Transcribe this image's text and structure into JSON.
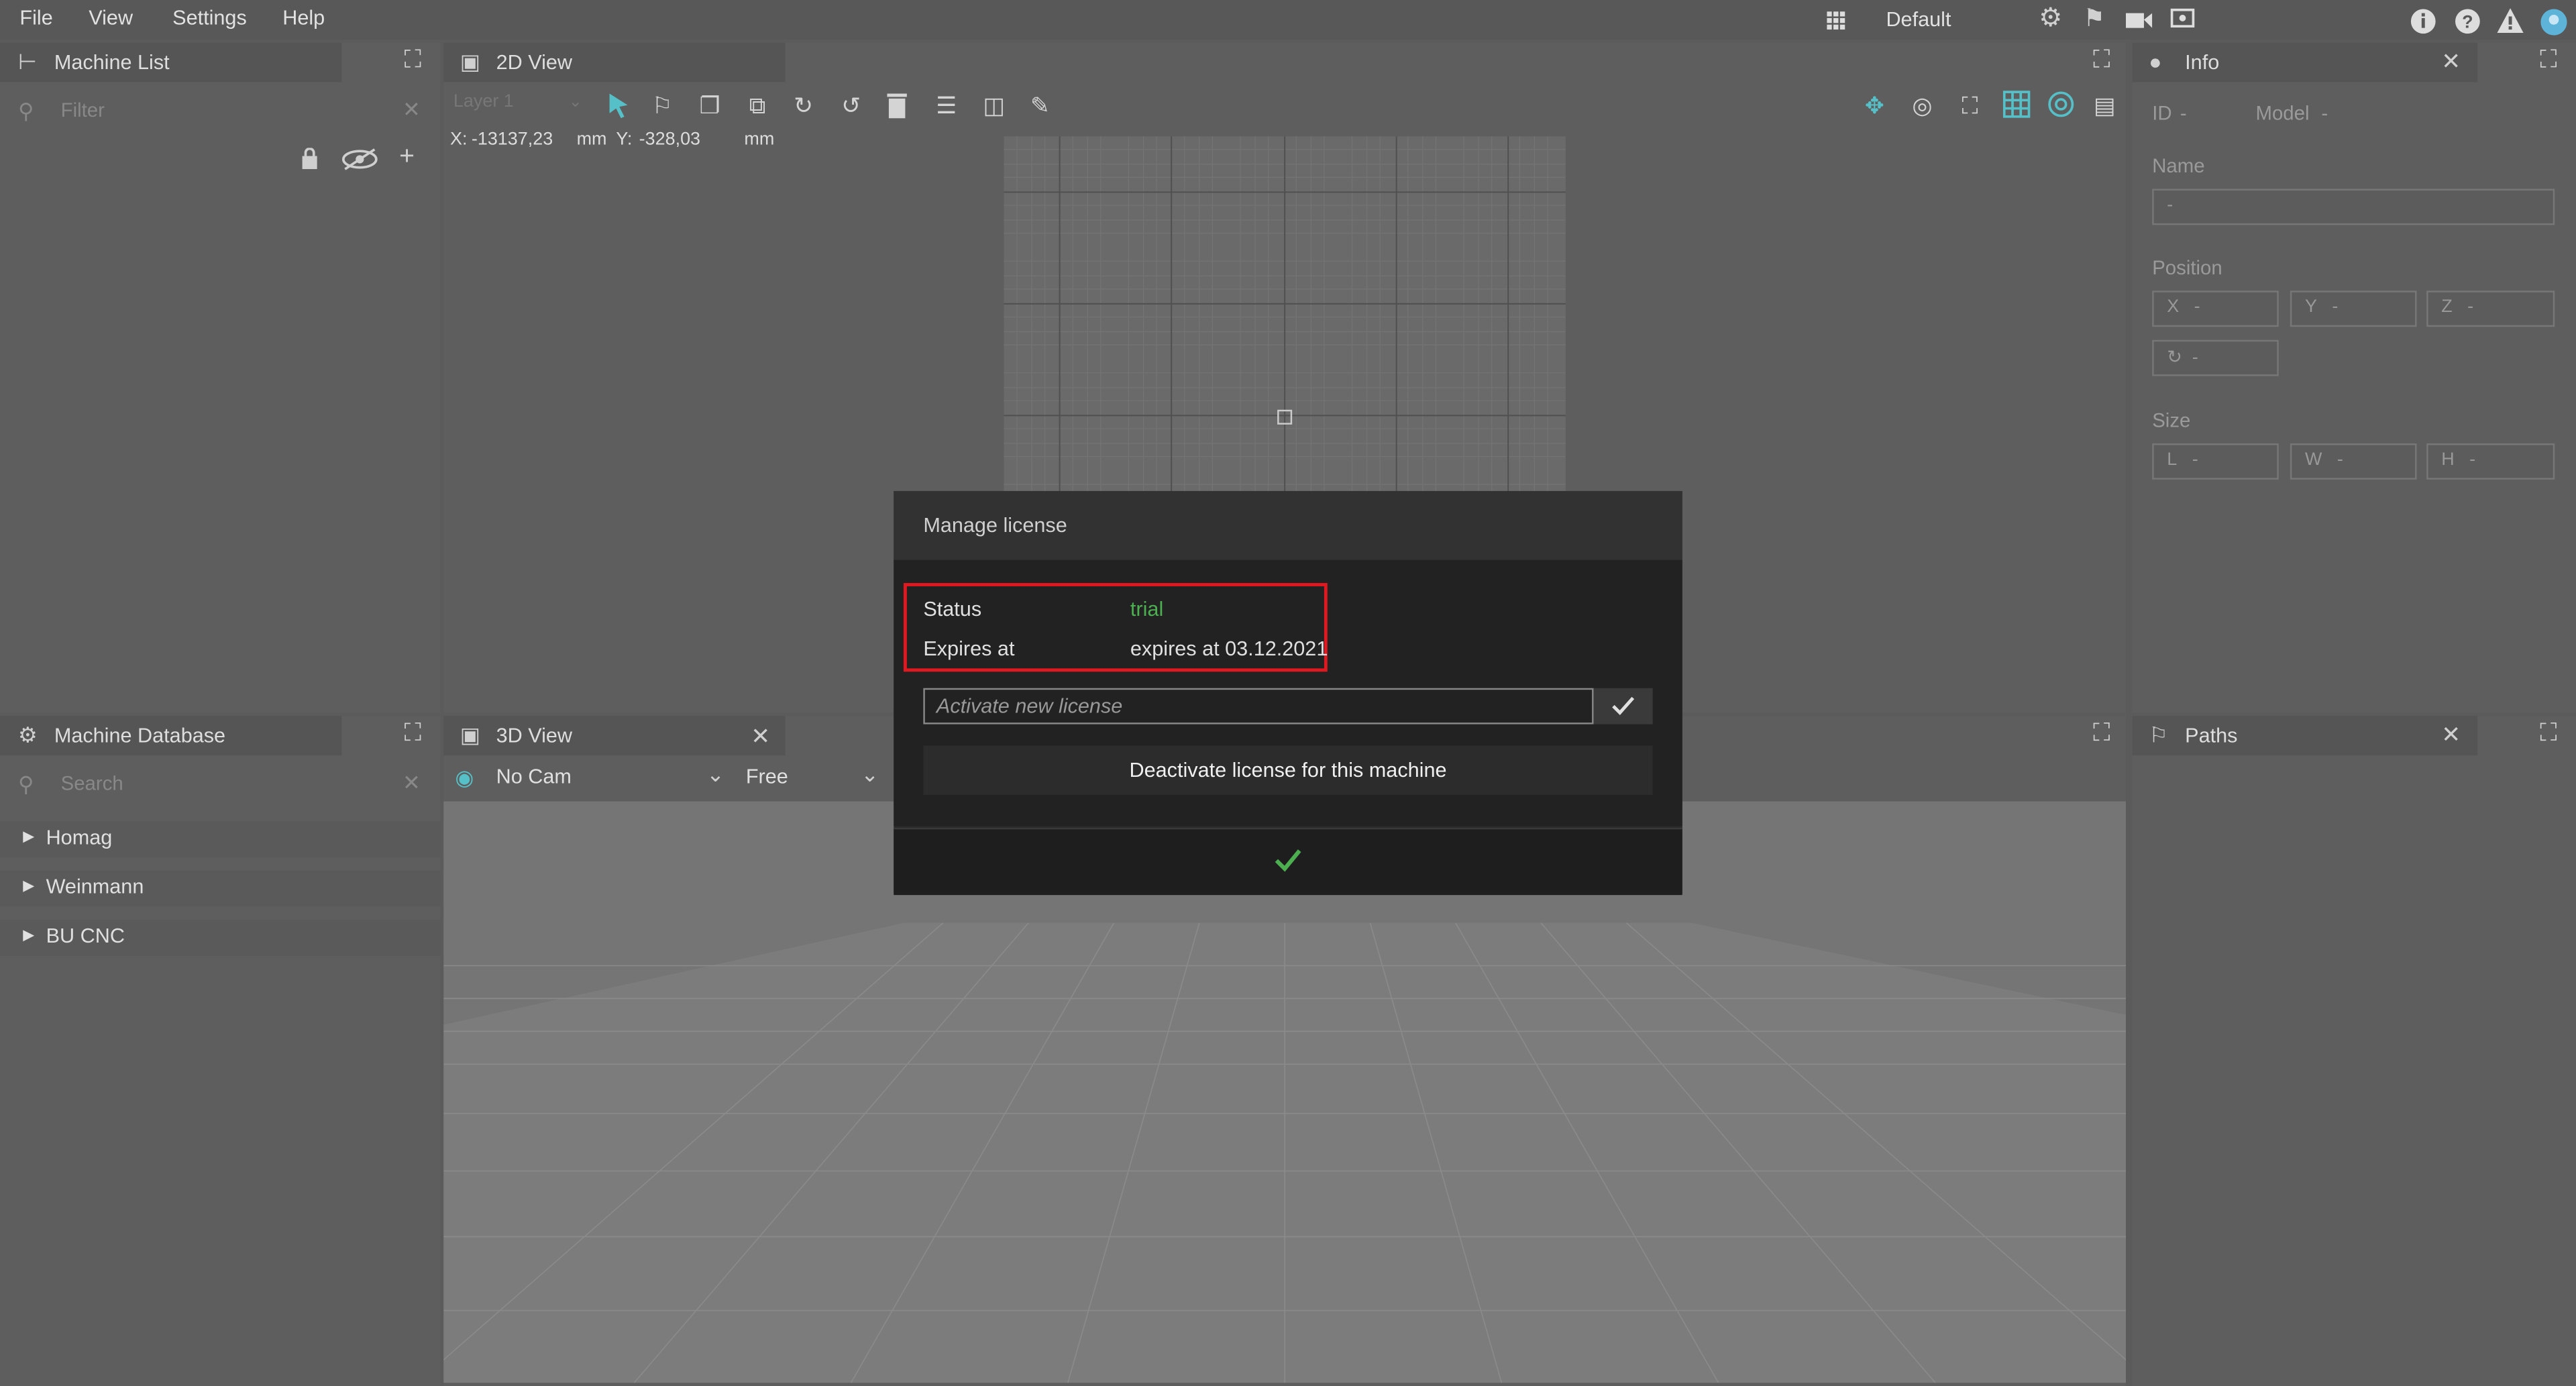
{
  "menu": {
    "file": "File",
    "view": "View",
    "settings": "Settings",
    "help": "Help",
    "layout": "Default"
  },
  "colors": {
    "accent": "#56c0c8",
    "success": "#4caf50",
    "highlight": "#e0181f"
  },
  "machine_list": {
    "title": "Machine List",
    "filter_placeholder": "Filter"
  },
  "view2d": {
    "title": "2D View",
    "layer": "Layer 1",
    "x_label": "X:",
    "x_value": "-13137,23",
    "x_unit": "mm",
    "y_label": "Y:",
    "y_value": "-328,03",
    "y_unit": "mm"
  },
  "info": {
    "title": "Info",
    "id_label": "ID",
    "id_value": "-",
    "model_label": "Model",
    "model_value": "-",
    "name_label": "Name",
    "name_value": "-",
    "position_label": "Position",
    "x": "X",
    "y": "Y",
    "z": "Z",
    "x_value": "-",
    "y_value": "-",
    "z_value": "-",
    "rot_value": "-",
    "size_label": "Size",
    "l": "L",
    "w": "W",
    "h": "H",
    "l_value": "-",
    "w_value": "-",
    "h_value": "-"
  },
  "machine_db": {
    "title": "Machine Database",
    "search_placeholder": "Search",
    "items": [
      "Homag",
      "Weinmann",
      "BU CNC"
    ]
  },
  "view3d": {
    "title": "3D View",
    "cam": "No Cam",
    "mode": "Free"
  },
  "paths": {
    "title": "Paths"
  },
  "license": {
    "title": "Manage license",
    "status_label": "Status",
    "status_value": "trial",
    "expires_label": "Expires at",
    "expires_value": "expires at 03.12.2021",
    "activate_placeholder": "Activate new license",
    "deactivate_label": "Deactivate license for this machine"
  }
}
